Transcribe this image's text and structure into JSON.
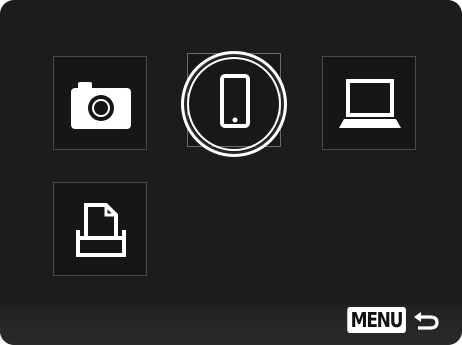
{
  "menu": {
    "items": [
      {
        "name": "camera",
        "icon": "camera-icon",
        "selected": false
      },
      {
        "name": "smartphone",
        "icon": "smartphone-icon",
        "selected": true
      },
      {
        "name": "computer",
        "icon": "laptop-icon",
        "selected": false
      },
      {
        "name": "printer",
        "icon": "printer-icon",
        "selected": false
      }
    ]
  },
  "footer": {
    "menu_label": "MENU",
    "back_icon": "return-arrow-icon"
  },
  "colors": {
    "background": "#1c1c1c",
    "icon": "#ffffff",
    "tile_border": "#4a4a4a",
    "selection_ring": "#ffffff"
  }
}
